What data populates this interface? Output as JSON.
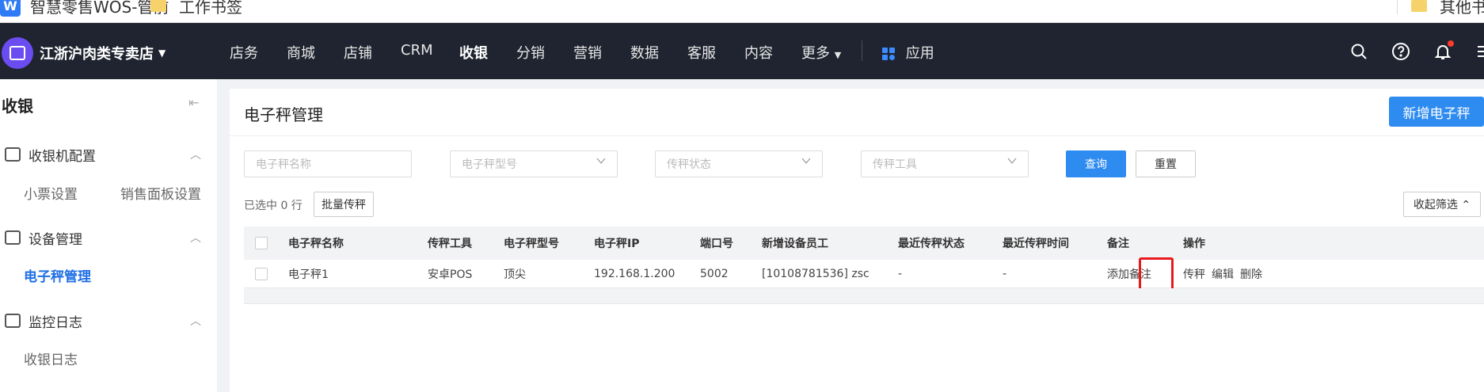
{
  "bookmarks": [
    {
      "label": "智慧零售WOS-管前"
    },
    {
      "label": "工作书签"
    },
    {
      "label": "其他书签"
    }
  ],
  "topnav": {
    "store_name": "江浙沪肉类专卖店",
    "items": [
      "店务",
      "商城",
      "店铺",
      "CRM",
      "收银",
      "分销",
      "营销",
      "数据",
      "客服",
      "内容",
      "更多"
    ],
    "active": "收银",
    "app_label": "应用"
  },
  "sidebar": {
    "title": "收银",
    "groups": [
      {
        "label": "收银机配置",
        "items": [
          "小票设置",
          "销售面板设置"
        ]
      },
      {
        "label": "设备管理",
        "items": [
          "电子秤管理"
        ]
      },
      {
        "label": "监控日志",
        "items": [
          "收银日志"
        ]
      }
    ],
    "active_item": "电子秤管理"
  },
  "main": {
    "title": "电子秤管理",
    "add_button": "新增电子秤",
    "filters": {
      "name_placeholder": "电子秤名称",
      "model_placeholder": "电子秤型号",
      "status_placeholder": "传秤状态",
      "tool_placeholder": "传秤工具"
    },
    "query_button": "查询",
    "reset_button": "重置",
    "selected_text": "已选中 0 行",
    "batch_button": "批量传秤",
    "collapse_button": "收起筛选 ⌃"
  },
  "table": {
    "columns": [
      "电子秤名称",
      "传秤工具",
      "电子秤型号",
      "电子秤IP",
      "端口号",
      "新增设备员工",
      "最近传秤状态",
      "最近传秤时间",
      "备注",
      "操作"
    ],
    "rows": [
      {
        "name": "电子秤1",
        "tool": "安卓POS",
        "model": "顶尖",
        "ip": "192.168.1.200",
        "port": "5002",
        "employee": "[10108781536] zsc",
        "last_status": "-",
        "last_time": "-",
        "remark": "添加备注",
        "actions": [
          "传秤",
          "编辑",
          "删除"
        ]
      }
    ]
  },
  "colors": {
    "topnav_bg": "#1f2430",
    "primary": "#2e8bf0",
    "link": "#1f6fe5",
    "highlight_box": "#e8191e"
  }
}
